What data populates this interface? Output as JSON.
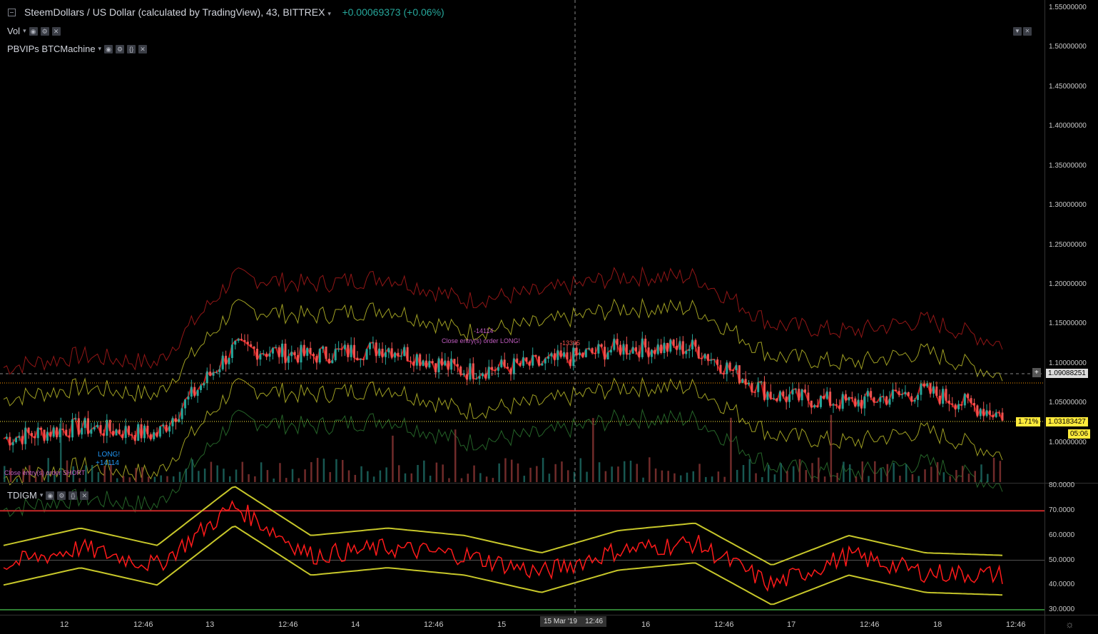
{
  "header": {
    "symbol": "SteemDollars / US Dollar (calculated by TradingView), 43, BITTREX",
    "change": "+0.00069373 (+0.06%)"
  },
  "indicators": {
    "vol": "Vol",
    "strategy": "PBVIPs BTCMachine",
    "oscillator": "TDIGM"
  },
  "price_axis": [
    "1.55000000",
    "1.50000000",
    "1.45000000",
    "1.40000000",
    "1.35000000",
    "1.30000000",
    "1.25000000",
    "1.20000000",
    "1.15000000",
    "1.10000000",
    "1.05000000",
    "1.00000000"
  ],
  "price_tags": {
    "crosshair_price": "1.09088251",
    "last_price": "1.03183427",
    "percent": "1.71%",
    "countdown": "05:06"
  },
  "osc_axis": [
    "80.0000",
    "70.0000",
    "60.0000",
    "50.0000",
    "40.0000",
    "30.0000"
  ],
  "time_axis": [
    "12",
    "12:46",
    "13",
    "12:46",
    "14",
    "12:46",
    "15",
    "16",
    "12:46",
    "17",
    "12:46",
    "18",
    "12:46"
  ],
  "time_cursor": [
    "15 Mar '19",
    "12:46"
  ],
  "annotations": {
    "short_close": "Close entry(s) order SHORT",
    "long": "LONG!",
    "long_amount": "+14114",
    "long_close": "Close entry(s) order LONG!",
    "short_amount_1": "-14114",
    "short_amount_2": "-13395"
  },
  "colors": {
    "up": "#26a69a",
    "down": "#ef5350",
    "signal_red": "#ff1a1a",
    "band_yellow": "#c7c72a",
    "band_red": "#b71c1c",
    "band_green": "#2e7d32",
    "tag_yellow": "#ffeb3b"
  },
  "chart_data": [
    {
      "type": "line",
      "title": "SteemDollars / US Dollar (calculated by TradingView), 43, BITTREX",
      "xlabel": "",
      "ylabel": "",
      "x": [
        "12",
        "12:46",
        "13",
        "12:46",
        "14",
        "12:46",
        "15",
        "12:46",
        "16",
        "12:46",
        "17",
        "12:46",
        "18",
        "12:46"
      ],
      "series": [
        {
          "values": [
            1.005,
            1.02,
            1.01,
            1.12,
            1.11,
            1.12,
            1.09,
            1.1,
            1.12,
            1.12,
            1.06,
            1.05,
            1.065,
            1.035
          ]
        }
      ],
      "ylim": [
        0.95,
        1.56
      ],
      "grid": false
    },
    {
      "type": "line",
      "title": "TDIGM",
      "xlabel": "",
      "ylabel": "",
      "x": [
        "12",
        "12:46",
        "13",
        "12:46",
        "14",
        "12:46",
        "15",
        "12:46",
        "16",
        "12:46",
        "17",
        "12:46",
        "18",
        "12:46"
      ],
      "series": [
        {
          "values": [
            48,
            55,
            48,
            72,
            52,
            55,
            52,
            45,
            54,
            57,
            40,
            52,
            45,
            44
          ]
        }
      ],
      "levels": [
        70,
        50,
        30
      ],
      "ylim": [
        28,
        81
      ],
      "grid": false
    }
  ]
}
